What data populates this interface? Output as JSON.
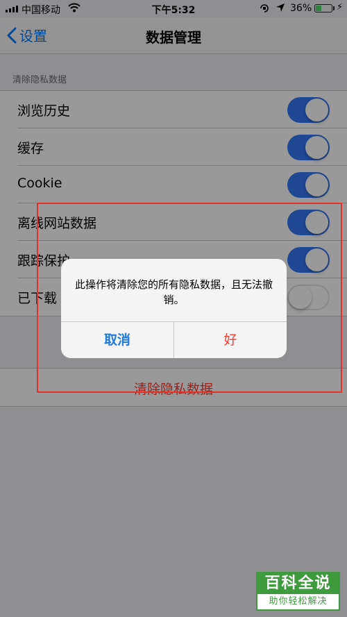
{
  "status_bar": {
    "carrier": "中国移动",
    "time": "下午5:32",
    "battery_pct": "36%",
    "battery_level": 0.36,
    "icons": [
      "signal-bars-icon",
      "wifi-icon",
      "rotation-lock-icon",
      "location-arrow-icon",
      "battery-icon",
      "charging-bolt-icon"
    ]
  },
  "nav": {
    "back_label": "设置",
    "title": "数据管理"
  },
  "section": {
    "header": "清除隐私数据",
    "items": [
      {
        "label": "浏览历史",
        "enabled": true
      },
      {
        "label": "缓存",
        "enabled": true
      },
      {
        "label": "Cookie",
        "enabled": true
      },
      {
        "label": "离线网站数据",
        "enabled": true
      },
      {
        "label": "跟踪保护",
        "enabled": true
      },
      {
        "label": "已下载",
        "enabled": false
      }
    ]
  },
  "clear_button": {
    "label": "清除隐私数据"
  },
  "alert": {
    "message": "此操作将清除您的所有隐私数据，且无法撤销。",
    "cancel_label": "取消",
    "ok_label": "好"
  },
  "watermark": {
    "top": "百科全说",
    "bottom": "助你轻松解决"
  },
  "colors": {
    "toggle_on": "#3478f6",
    "accent_blue": "#007aff",
    "destructive_red": "#ff3b30",
    "annotation_red": "#e5312a",
    "watermark_green": "#3d9b3d"
  }
}
